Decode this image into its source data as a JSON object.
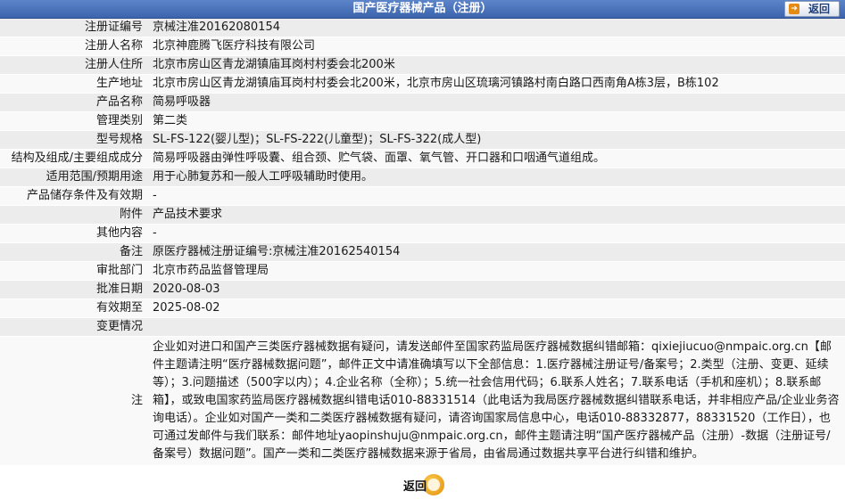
{
  "header": {
    "title": "国产医疗器械产品（注册）",
    "back_label": "返回"
  },
  "rows": [
    {
      "label": "注册证编号",
      "value": "京械注准20162080154"
    },
    {
      "label": "注册人名称",
      "value": "北京神鹿腾飞医疗科技有限公司"
    },
    {
      "label": "注册人住所",
      "value": "北京市房山区青龙湖镇庙耳岗村村委会北200米"
    },
    {
      "label": "生产地址",
      "value": "北京市房山区青龙湖镇庙耳岗村村委会北200米，北京市房山区琉璃河镇路村南白路口西南角A栋3层，B栋102"
    },
    {
      "label": "产品名称",
      "value": "简易呼吸器"
    },
    {
      "label": "管理类别",
      "value": "第二类"
    },
    {
      "label": "型号规格",
      "value": "SL-FS-122(婴儿型)；SL-FS-222(儿童型)；SL-FS-322(成人型)"
    },
    {
      "label": "结构及组成/主要组成成分",
      "value": "简易呼吸器由弹性呼吸囊、组合颈、贮气袋、面罩、氧气管、开口器和口咽通气道组成。"
    },
    {
      "label": "适用范围/预期用途",
      "value": "用于心肺复苏和一般人工呼吸辅助时使用。"
    },
    {
      "label": "产品储存条件及有效期",
      "value": "-"
    },
    {
      "label": "附件",
      "value": "产品技术要求"
    },
    {
      "label": "其他内容",
      "value": "-"
    },
    {
      "label": "备注",
      "value": "原医疗器械注册证编号:京械注准20162540154"
    },
    {
      "label": "审批部门",
      "value": "北京市药品监督管理局"
    },
    {
      "label": "批准日期",
      "value": "2020-08-03"
    },
    {
      "label": "有效期至",
      "value": "2025-08-02"
    },
    {
      "label": "变更情况",
      "value": ""
    }
  ],
  "note": {
    "label": "注",
    "text": "企业如对进口和国产三类医疗器械数据有疑问，请发送邮件至国家药监局医疗器械数据纠错邮箱：qixiejiucuo@nmpaic.org.cn【邮件主题请注明“医疗器械数据问题”，邮件正文中请准确填写以下全部信息：1.医疗器械注册证号/备案号；2.类型（注册、变更、延续等）；3.问题描述（500字以内）；4.企业名称（全称）；5.统一社会信用代码；6.联系人姓名；7.联系电话（手机和座机）；8.联系邮箱】，或致电国家药监局医疗器械数据纠错电话010-88331514（此电话为我局医疗器械数据纠错联系电话，并非相应产品/企业业务咨询电话）。企业如对国产一类和二类医疗器械数据有疑问，请咨询国家局信息中心，电话010-88332877，88331520（工作日），也可通过发邮件与我们联系：邮件地址yaopinshuju@nmpaic.org.cn，邮件主题请注明“国产医疗器械产品（注册）-数据（注册证号/备案号）数据问题”。国产一类和二类医疗器械数据来源于省局，由省局通过数据共享平台进行纠错和维护。"
  },
  "footer": {
    "back_label": "返回"
  }
}
